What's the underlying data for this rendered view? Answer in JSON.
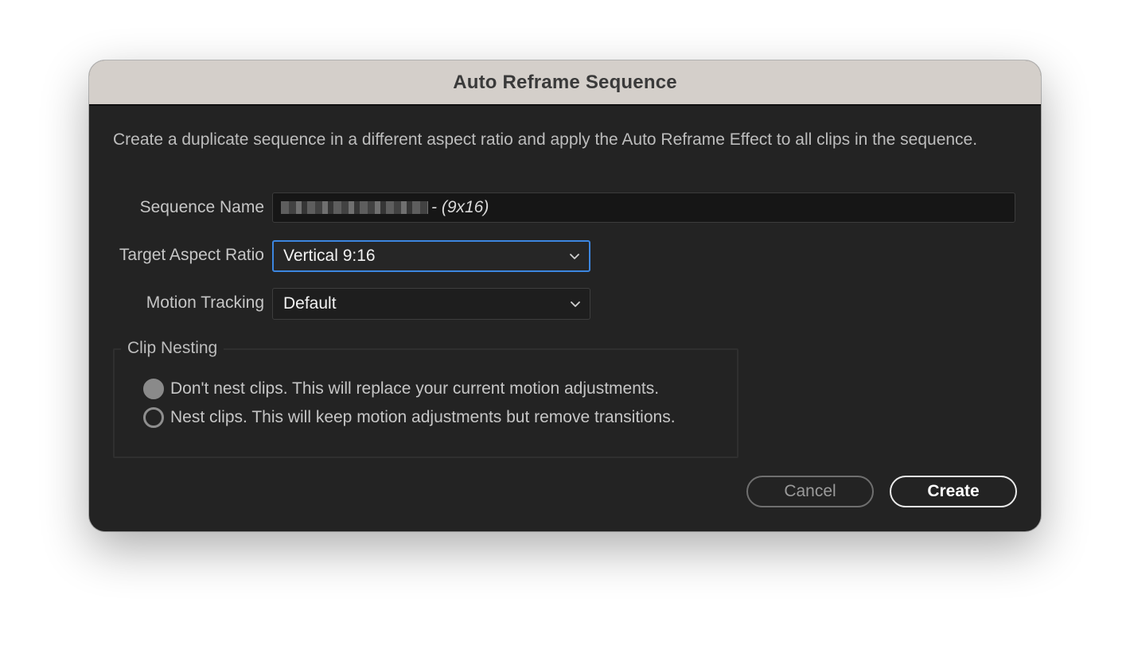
{
  "dialog": {
    "title": "Auto Reframe Sequence",
    "description": "Create a duplicate sequence in a different aspect ratio and apply the Auto Reframe Effect to all clips in the sequence."
  },
  "sequence_name": {
    "label": "Sequence Name",
    "value_suffix": "- (9x16)",
    "value_prefix_redacted": true
  },
  "target_aspect_ratio": {
    "label": "Target Aspect Ratio",
    "selected": "Vertical 9:16"
  },
  "motion_tracking": {
    "label": "Motion Tracking",
    "selected": "Default"
  },
  "clip_nesting": {
    "legend": "Clip Nesting",
    "options": [
      {
        "label": "Don't nest clips. This will replace your current motion adjustments.",
        "selected": true
      },
      {
        "label": "Nest clips. This will keep motion adjustments but remove transitions.",
        "selected": false
      }
    ]
  },
  "buttons": {
    "cancel": "Cancel",
    "create": "Create"
  },
  "colors": {
    "dialog_bg": "#232323",
    "titlebar_bg": "#d4cfca",
    "focus_accent": "#3c86e0"
  },
  "icons": {
    "dropdown": "chevron-down-icon",
    "radio_on": "radio-selected-icon",
    "radio_off": "radio-unselected-icon"
  }
}
